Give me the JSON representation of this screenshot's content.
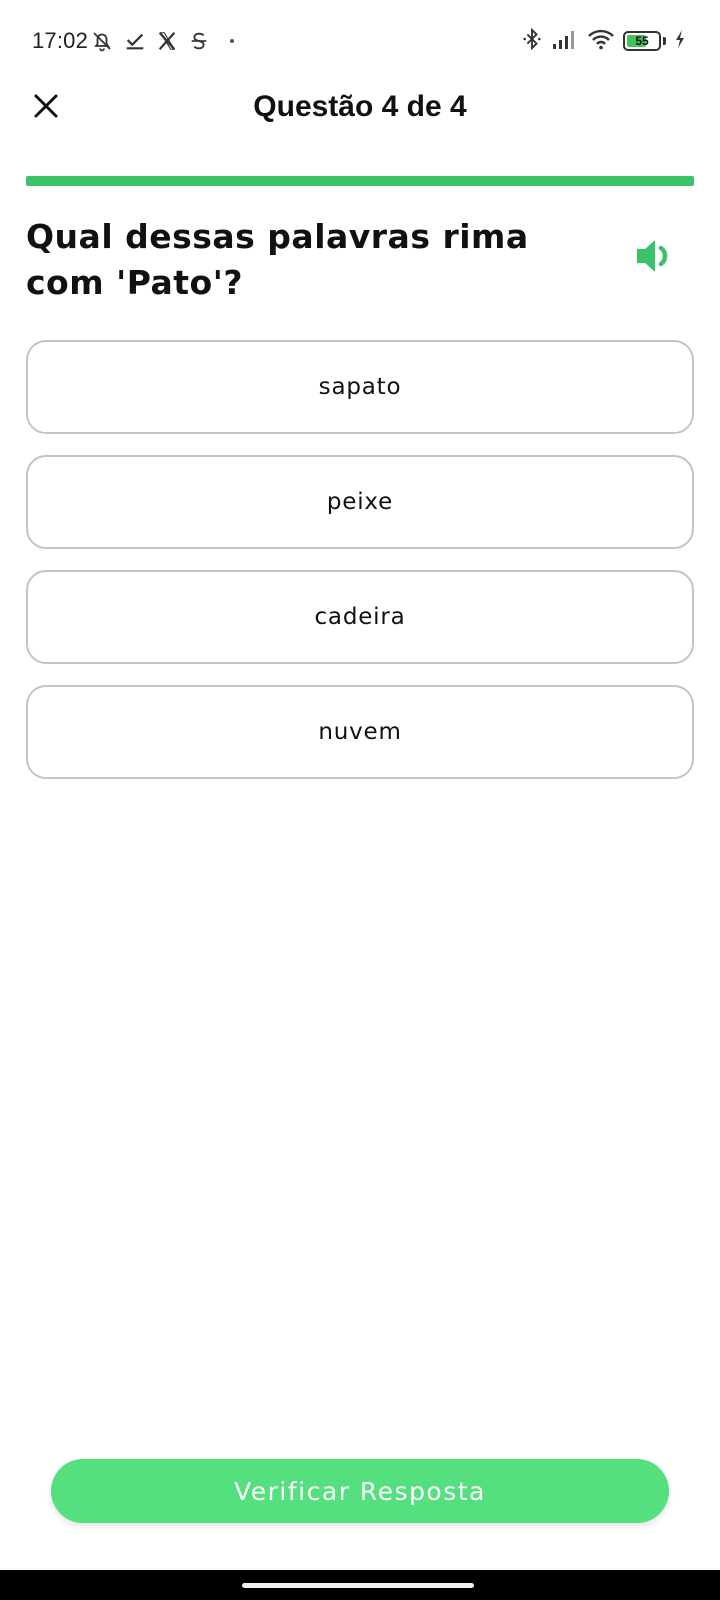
{
  "status_bar": {
    "time": "17:02",
    "left_icons": [
      "bell-off-icon",
      "check-icon",
      "x-logo-icon",
      "strikethrough-s-icon",
      "dot-icon"
    ],
    "right_icons": [
      "bluetooth-icon",
      "signal-icon",
      "wifi-icon",
      "battery-icon",
      "charging-bolt-icon"
    ],
    "battery_level": "55"
  },
  "header": {
    "close_icon": "close-icon",
    "title": "Questão 4 de 4"
  },
  "progress": {
    "current": 4,
    "total": 4,
    "fraction": 1.0,
    "color": "#3cc36a"
  },
  "question": {
    "text": "Qual dessas palavras rima com 'Pato'?",
    "audio_icon": "speaker-icon",
    "audio_icon_color": "#3cc36a"
  },
  "options": [
    {
      "label": "sapato"
    },
    {
      "label": "peixe"
    },
    {
      "label": "cadeira"
    },
    {
      "label": "nuvem"
    }
  ],
  "actions": {
    "verify_label": "Verificar Resposta",
    "verify_color": "#55e07f"
  }
}
